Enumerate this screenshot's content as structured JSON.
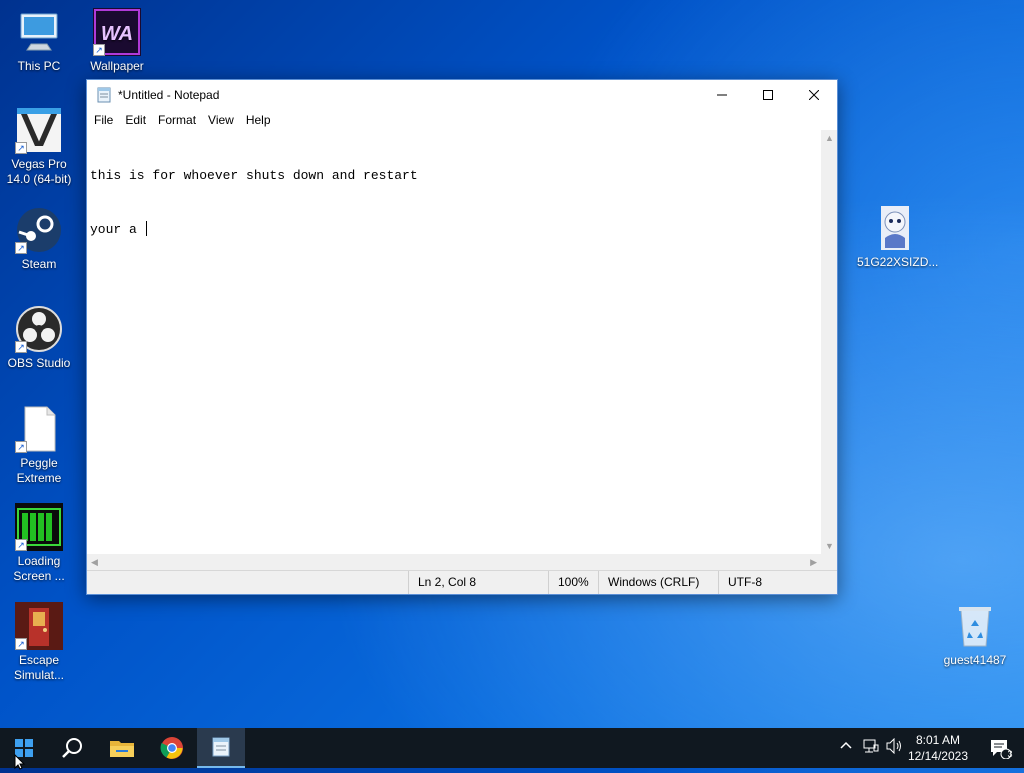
{
  "desktop": {
    "icons_left": [
      {
        "label": "This PC",
        "icon": "this-pc-icon"
      },
      {
        "label": "Wallpaper",
        "icon": "wallpaper-engine-icon",
        "logo_text": "WA"
      },
      {
        "label": "Vegas Pro 14.0 (64-bit)",
        "icon": "vegas-pro-icon"
      },
      {
        "label": "Steam",
        "icon": "steam-icon"
      },
      {
        "label": "OBS Studio",
        "icon": "obs-icon"
      },
      {
        "label": "Peggle Extreme",
        "icon": "document-icon"
      },
      {
        "label": "Loading Screen ...",
        "icon": "loading-screen-icon"
      },
      {
        "label": "Escape Simulat...",
        "icon": "escape-simulator-icon"
      }
    ],
    "icons_right": [
      {
        "label": "51G22XSIZD...",
        "icon": "image-file-icon"
      },
      {
        "label": "guest41487",
        "icon": "recycle-bin-icon"
      }
    ]
  },
  "notepad": {
    "title": "*Untitled - Notepad",
    "menu": [
      "File",
      "Edit",
      "Format",
      "View",
      "Help"
    ],
    "content_lines": [
      "this is for whoever shuts down and restart",
      "your a "
    ],
    "status": {
      "position": "Ln 2, Col 8",
      "zoom": "100%",
      "line_ending": "Windows (CRLF)",
      "encoding": "UTF-8"
    }
  },
  "taskbar": {
    "pinned": [
      "start-icon",
      "search-icon",
      "file-explorer-icon",
      "chrome-icon",
      "notepad-icon"
    ],
    "active": "notepad-icon",
    "clock": {
      "time": "8:01 AM",
      "date": "12/14/2023"
    },
    "notification_count": "3"
  },
  "colors": {
    "taskbar": "#101820",
    "accent": "#76b9ed"
  }
}
